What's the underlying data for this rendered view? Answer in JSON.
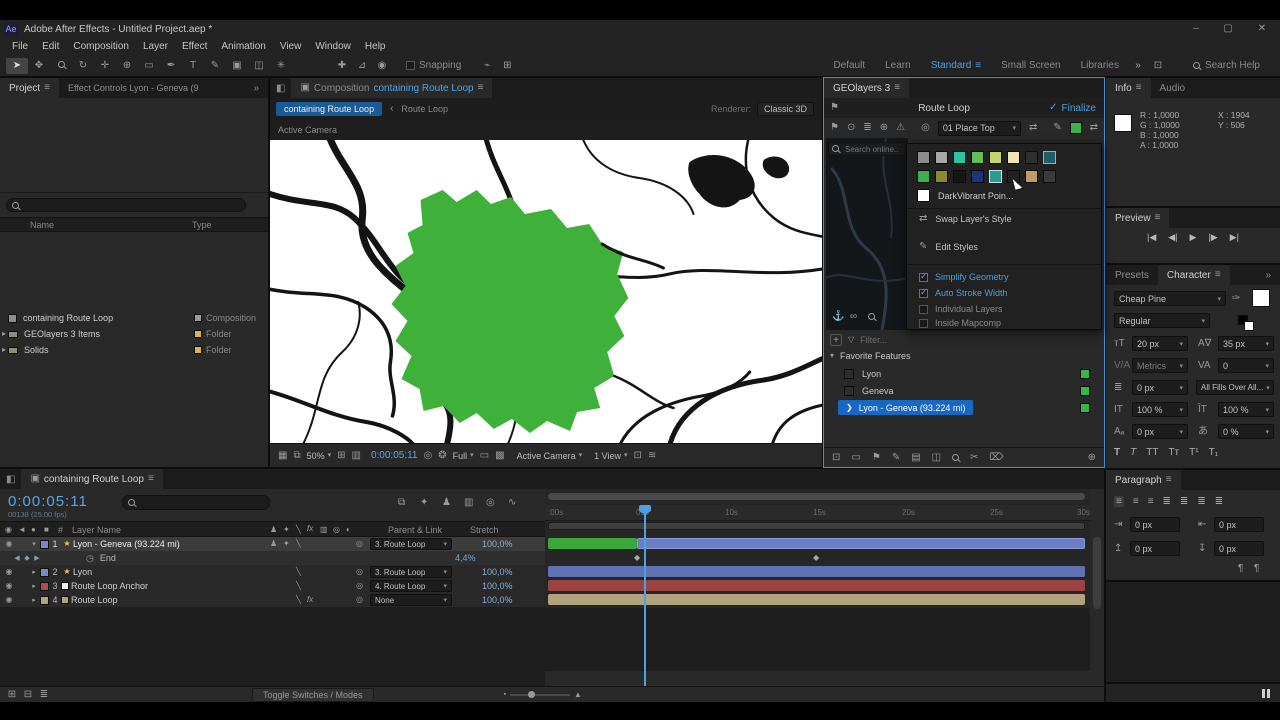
{
  "colors": {
    "accent_blue": "#4a90d9",
    "selection_blue": "#1668c4",
    "map_green": "#3fb13b",
    "bar_blue": "#5e72b4",
    "bar_red": "#9c4444",
    "bar_tan": "#b2a27d",
    "time_blue": "#5aa7dd"
  },
  "titlebar": {
    "app_icon": "Ae",
    "title": "Adobe After Effects - Untitled Project.aep *"
  },
  "menubar": {
    "items": [
      "File",
      "Edit",
      "Composition",
      "Layer",
      "Effect",
      "Animation",
      "View",
      "Window",
      "Help"
    ]
  },
  "toolbar": {
    "snapping": "Snapping",
    "workspaces": [
      "Default",
      "Learn",
      "Standard",
      "Small Screen",
      "Libraries"
    ],
    "search_help": "Search Help"
  },
  "project": {
    "tab_project": "Project",
    "tab_effect_controls": "Effect Controls Lyon - Geneva (9",
    "col_name": "Name",
    "col_type": "Type",
    "rows": [
      {
        "name": "containing Route Loop",
        "type": "Composition"
      },
      {
        "name": "GEOlayers 3 Items",
        "type": "Folder"
      },
      {
        "name": "Solids",
        "type": "Folder"
      }
    ]
  },
  "comp": {
    "tab_prefix": "Composition",
    "tab_name": "containing Route Loop",
    "crumb_comp": "containing Route Loop",
    "crumb_layer": "Route Loop",
    "renderer_label": "Renderer:",
    "renderer_value": "Classic 3D",
    "view_label": "Active Camera",
    "zoom": "50%",
    "time": "0:00:05:11",
    "resolution": "Full",
    "camera": "Active Camera",
    "view_layout": "1 View"
  },
  "geo": {
    "tab": "GEOlayers 3",
    "header": "Route Loop",
    "finalize": "Finalize",
    "place_mode": "01 Place Top",
    "search_placeholder": "Search online...",
    "style_name": "DarkVibrant Poin...",
    "swap_style": "Swap Layer's Style",
    "edit_styles": "Edit Styles",
    "opt_simplify": "Simplify Geometry",
    "opt_auto_stroke": "Auto Stroke Width",
    "opt_individual": "Individual Layers",
    "opt_inside": "Inside Mapcomp",
    "filter_placeholder": "Filter...",
    "favorites_header": "Favorite Features",
    "favorites": [
      {
        "label": "Lyon"
      },
      {
        "label": "Geneva"
      },
      {
        "label": "Lyon - Geneva (93.224 mi)"
      }
    ],
    "palette_row1": [
      "#8c8c8c",
      "#a8a8a8",
      "#2fc49e",
      "#63bd58",
      "#c4d66e",
      "#eee6ae",
      "#2e2e2e",
      "#1f6066"
    ],
    "palette_row2": [
      "#3cb24a",
      "#8a8a30",
      "#161616",
      "#20327e",
      "#2a9d8f",
      "#202020",
      "#c39a66",
      "#3a3a3a"
    ]
  },
  "info": {
    "tab_info": "Info",
    "tab_audio": "Audio",
    "r": "R : 1,0000",
    "g": "G : 1,0000",
    "b": "B : 1,0000",
    "a": "A : 1,0000",
    "x": "X : 1904",
    "y": "Y : 506"
  },
  "preview": {
    "title": "Preview"
  },
  "character": {
    "tab_presets": "Presets",
    "tab_character": "Character",
    "font": "Cheap Pine",
    "style": "Regular",
    "size": "20 px",
    "kerning": "35 px",
    "metrics": "Metrics",
    "tracking": "0",
    "stroke_width": "0 px",
    "fill_mode": "All Fills Over All...",
    "v_scale": "100 %",
    "h_scale": "100 %",
    "baseline": "0 px",
    "tsume": "0 %"
  },
  "paragraph": {
    "title": "Paragraph",
    "indent_left": "0 px",
    "indent_right": "0 px",
    "space_before": "0 px",
    "space_after": "0 px"
  },
  "timeline": {
    "tab": "containing Route Loop",
    "time": "0:00:05:11",
    "frame_info": "00138 (25.00 fps)",
    "col_number": "#",
    "col_layer_name": "Layer Name",
    "col_parent": "Parent & Link",
    "col_stretch": "Stretch",
    "ticks": [
      ":00s",
      "05s",
      "10s",
      "15s",
      "20s",
      "25s",
      "30s"
    ],
    "layers": [
      {
        "num": "1",
        "name": "Lyon - Geneva (93.224 mi)",
        "parent": "3. Route Loop",
        "stretch": "100,0%"
      },
      {
        "num": "2",
        "name": "Lyon",
        "parent": "3. Route Loop",
        "stretch": "100,0%"
      },
      {
        "num": "3",
        "name": "Route Loop Anchor",
        "parent": "4. Route Loop",
        "stretch": "100,0%"
      },
      {
        "num": "4",
        "name": "Route Loop",
        "parent": "None",
        "stretch": "100,0%"
      }
    ],
    "end_property": "End",
    "end_value": "4,4%",
    "toggle_switches": "Toggle Switches / Modes"
  }
}
